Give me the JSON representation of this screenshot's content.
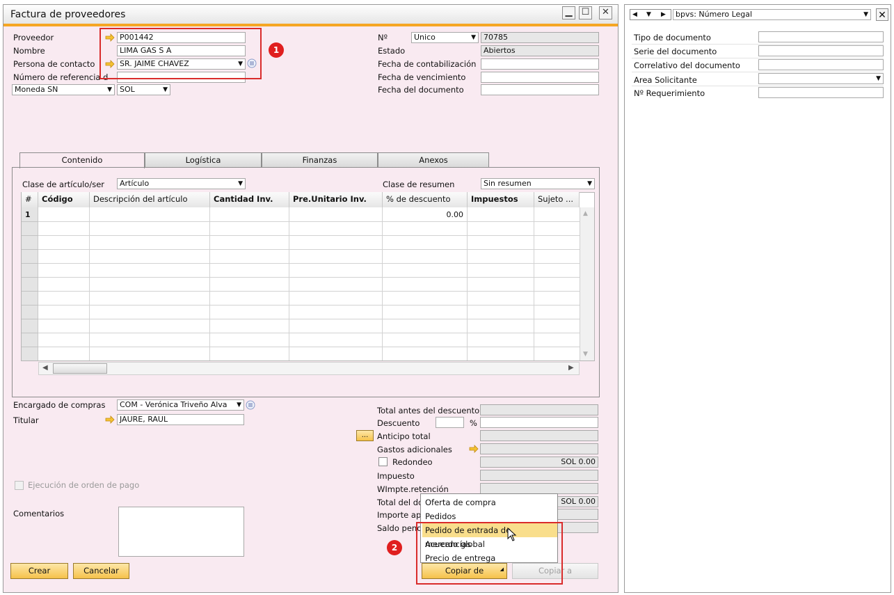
{
  "window": {
    "title": "Factura de proveedores"
  },
  "header": {
    "proveedor_label": "Proveedor",
    "proveedor_value": "P001442",
    "nombre_label": "Nombre",
    "nombre_value": "LIMA GAS S A",
    "contacto_label": "Persona de contacto",
    "contacto_value": "SR. JAIME CHAVEZ",
    "referencia_label": "Número de referencia d",
    "moneda_label": "Moneda SN",
    "moneda_value": "SOL",
    "no_label": "Nº",
    "serie_value": "Unico",
    "numero_value": "70785",
    "estado_label": "Estado",
    "estado_value": "Abiertos",
    "fecha_contab_label": "Fecha de contabilización",
    "fecha_venc_label": "Fecha de vencimiento",
    "fecha_doc_label": "Fecha del documento"
  },
  "badges": {
    "one": "1",
    "two": "2"
  },
  "tabs": [
    {
      "label": "Contenido"
    },
    {
      "label": "Logística"
    },
    {
      "label": "Finanzas"
    },
    {
      "label": "Anexos"
    }
  ],
  "contenido": {
    "clase_label": "Clase de artículo/ser",
    "clase_value": "Artículo",
    "resumen_label": "Clase de resumen",
    "resumen_value": "Sin resumen",
    "columns": [
      "#",
      "Código",
      "Descripción del artículo",
      "Cantidad Inv.",
      "Pre.Unitario Inv.",
      "% de descuento",
      "Impuestos",
      "Sujeto ..."
    ],
    "row1": {
      "num": "1",
      "descuento": "0.00"
    }
  },
  "footer": {
    "encargado_label": "Encargado de compras",
    "encargado_value": "COM - Verónica Triveño Alva",
    "titular_label": "Titular",
    "titular_value": "JAURE, RAUL",
    "ejecucion_label": "Ejecución de orden de pago",
    "comentarios_label": "Comentarios",
    "totals": {
      "total_antes_label": "Total antes del descuento",
      "descuento_label": "Descuento",
      "pct": "%",
      "anticipo_label": "Anticipo total",
      "ellipsis": "...",
      "gastos_label": "Gastos adicionales",
      "redondeo_label": "Redondeo",
      "redondeo_value": "SOL 0.00",
      "impuesto_label": "Impuesto",
      "wimpte_label": "WImpte.retención",
      "total_doc_label": "Total del do",
      "total_doc_value": "SOL 0.00",
      "importe_label": "Importe ap",
      "saldo_label": "Saldo pend"
    },
    "buttons": {
      "crear": "Crear",
      "cancelar": "Cancelar",
      "copiar_de": "Copiar de",
      "copiar_a": "Copiar a"
    }
  },
  "copy_menu": {
    "items": [
      "Oferta de compra",
      "Pedidos",
      "Pedido de entrada de mercancías",
      "Acuerdo global",
      "Precio de entrega"
    ],
    "selected": 2
  },
  "udf_panel": {
    "selector_value": "bpvs: Número Legal",
    "fields": [
      {
        "label": "Tipo de documento"
      },
      {
        "label": "Serie del documento"
      },
      {
        "label": "Correlativo del documento"
      },
      {
        "label": "Area Solicitante"
      },
      {
        "label": "Nº Requerimiento"
      }
    ]
  },
  "colors": {
    "accent": "#f5a623",
    "window_bg": "#f9eaf1",
    "highlight": "#d92b2b",
    "menu_selected": "#f9de8c"
  }
}
